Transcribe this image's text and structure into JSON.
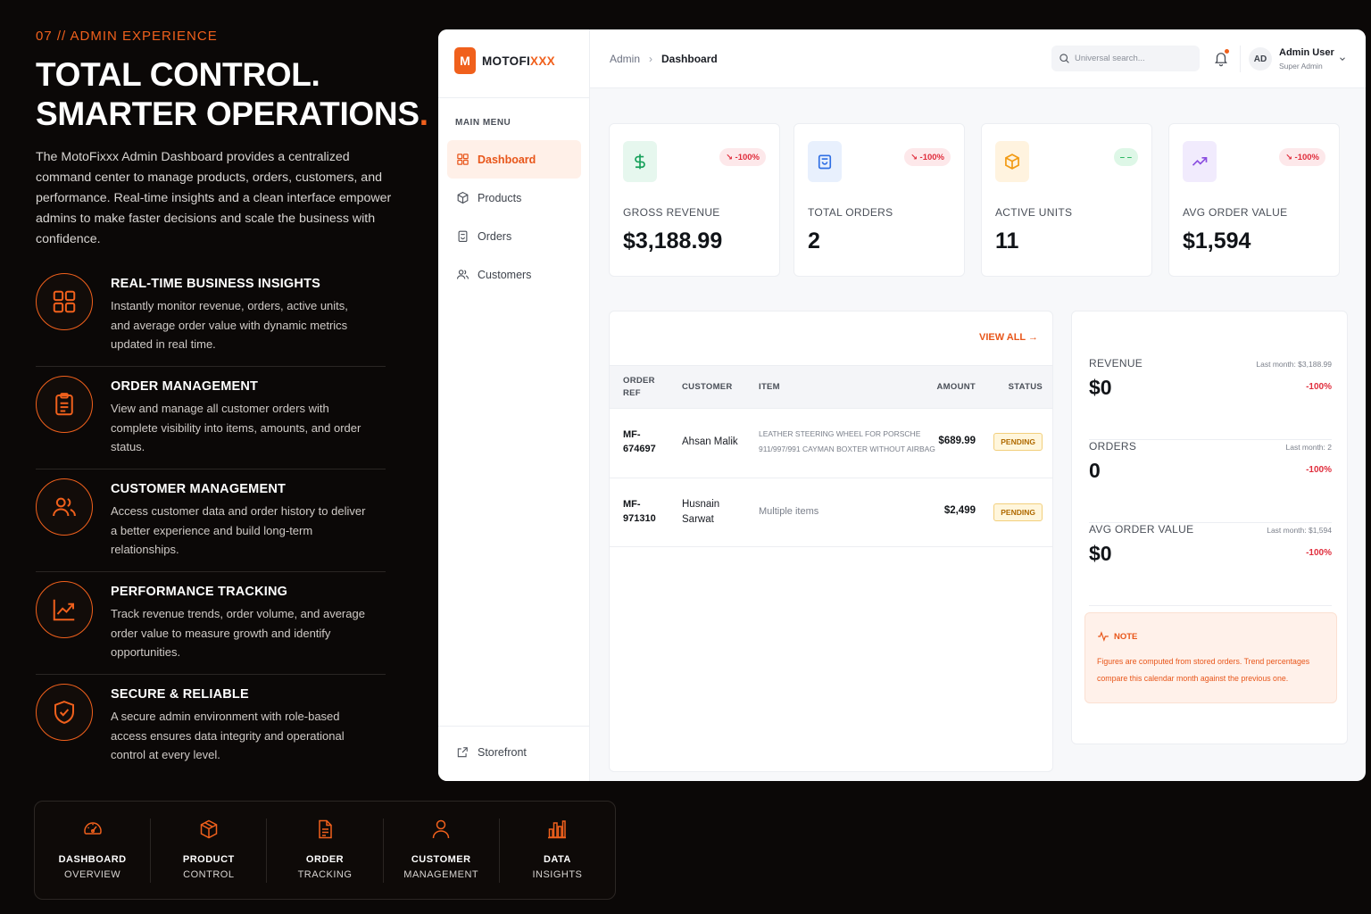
{
  "promo": {
    "kicker": "07 // ADMIN EXPERIENCE",
    "headline_line1": "TOTAL CONTROL.",
    "headline_line2": "SMARTER OPERATIONS",
    "headline_dot": ".",
    "intro": "The MotoFixxx Admin Dashboard provides a centralized command center to manage products, orders, customers, and performance. Real-time insights and a clean interface empower admins to make faster decisions and scale the business with confidence.",
    "features": [
      {
        "icon": "grid-icon",
        "title": "REAL-TIME BUSINESS INSIGHTS",
        "desc": "Instantly monitor revenue, orders, active units, and average order value with dynamic metrics updated in real time."
      },
      {
        "icon": "clipboard-icon",
        "title": "ORDER MANAGEMENT",
        "desc": "View and manage all customer orders with complete visibility into items, amounts, and order status."
      },
      {
        "icon": "users-icon",
        "title": "CUSTOMER MANAGEMENT",
        "desc": "Access customer data and order history to deliver a better experience and build long-term relationships."
      },
      {
        "icon": "trend-chart-icon",
        "title": "PERFORMANCE TRACKING",
        "desc": "Track revenue trends, order volume, and average order value to measure growth and identify opportunities."
      },
      {
        "icon": "shield-check-icon",
        "title": "SECURE & RELIABLE",
        "desc": "A secure admin environment with role-based access ensures data integrity and operational control at every level."
      }
    ],
    "bottom_items": [
      {
        "icon": "gauge-icon",
        "line1": "DASHBOARD",
        "line2": "OVERVIEW"
      },
      {
        "icon": "box-icon",
        "line1": "PRODUCT",
        "line2": "CONTROL"
      },
      {
        "icon": "document-icon",
        "line1": "ORDER",
        "line2": "TRACKING"
      },
      {
        "icon": "user-icon",
        "line1": "CUSTOMER",
        "line2": "MANAGEMENT"
      },
      {
        "icon": "bar-chart-icon",
        "line1": "DATA",
        "line2": "INSIGHTS"
      }
    ],
    "accent": "#f0601c"
  },
  "app": {
    "logo_letter": "M",
    "brand_a": "MOTOFI",
    "brand_b": "XXX",
    "menu_label": "MAIN MENU",
    "menu": [
      {
        "icon": "dashboard-icon",
        "label": "Dashboard",
        "active": true
      },
      {
        "icon": "box-icon",
        "label": "Products",
        "active": false
      },
      {
        "icon": "clipboard-icon",
        "label": "Orders",
        "active": false
      },
      {
        "icon": "users-icon",
        "label": "Customers",
        "active": false
      }
    ],
    "storefront": "Storefront",
    "breadcrumb": {
      "root": "Admin",
      "sep": "›",
      "current": "Dashboard"
    },
    "search": {
      "placeholder": "Universal search..."
    },
    "user": {
      "initials": "AD",
      "name": "Admin User",
      "role": "Super Admin"
    }
  },
  "kpis": [
    {
      "icon": "dollar-icon",
      "icon_bg": "#e6f7ee",
      "icon_color": "#16a05a",
      "badge": "↘ -100%",
      "badge_type": "neg",
      "label": "GROSS REVENUE",
      "value": "$3,188.99"
    },
    {
      "icon": "bag-icon",
      "icon_bg": "#e8f0fd",
      "icon_color": "#2f6fe4",
      "badge": "↘ -100%",
      "badge_type": "neg",
      "label": "TOTAL ORDERS",
      "value": "2"
    },
    {
      "icon": "cube-icon",
      "icon_bg": "#fff3df",
      "icon_color": "#f29a12",
      "badge": "– –",
      "badge_type": "neu",
      "label": "ACTIVE UNITS",
      "value": "11"
    },
    {
      "icon": "trend-up-icon",
      "icon_bg": "#f1ebfd",
      "icon_color": "#8a4de0",
      "badge": "↘ -100%",
      "badge_type": "neg",
      "label": "AVG ORDER VALUE",
      "value": "$1,594"
    }
  ],
  "orders": {
    "view_all": "VIEW ALL →",
    "columns": {
      "ref": "ORDER REF",
      "customer": "CUSTOMER",
      "item": "ITEM",
      "amount": "AMOUNT",
      "status": "STATUS"
    },
    "rows": [
      {
        "ref": "MF-674697",
        "customer": "Ahsan Malik",
        "item": "LEATHER STEERING WHEEL FOR PORSCHE 911/997/991 CAYMAN BOXTER WITHOUT AIRBAG",
        "amount": "$689.99",
        "status": "PENDING"
      },
      {
        "ref": "MF-971310",
        "customer": "Husnain Sarwat",
        "item": "Multiple items",
        "amount": "$2,499",
        "status": "PENDING"
      }
    ]
  },
  "summary": {
    "rows": [
      {
        "label": "REVENUE",
        "value": "$0",
        "last": "Last month: $3,188.99",
        "change": "-100%"
      },
      {
        "label": "ORDERS",
        "value": "0",
        "last": "Last month: 2",
        "change": "-100%"
      },
      {
        "label": "AVG ORDER VALUE",
        "value": "$0",
        "last": "Last month: $1,594",
        "change": "-100%"
      }
    ],
    "note_title": "NOTE",
    "note_body": "Figures are computed from stored orders. Trend percentages compare this calendar month against the previous one."
  }
}
